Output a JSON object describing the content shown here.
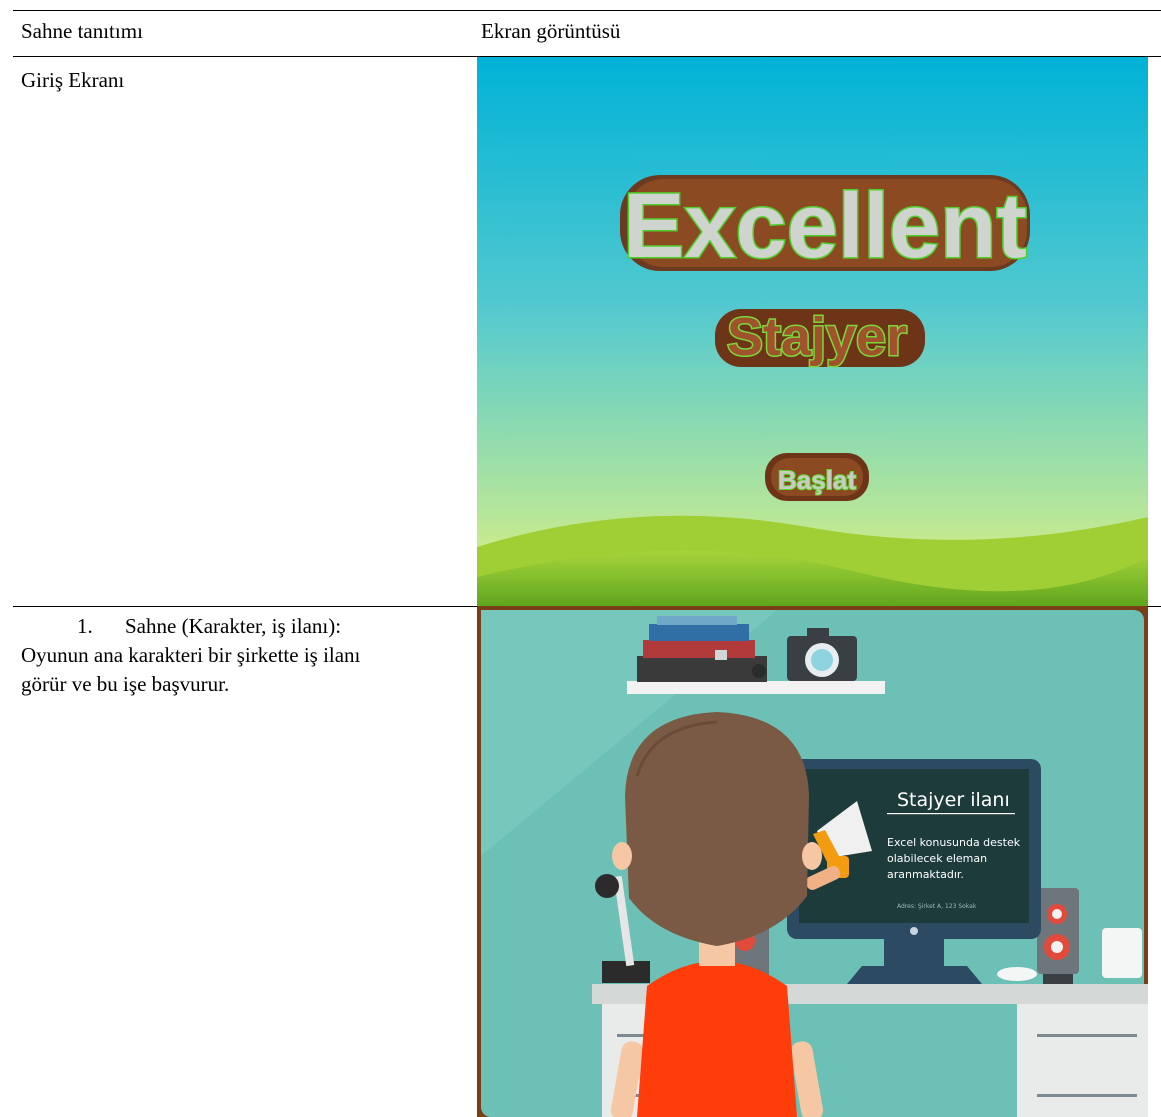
{
  "table": {
    "headers": {
      "left": "Sahne tanıtımı",
      "right": "Ekran görüntüsü"
    },
    "rows": [
      {
        "description": "Giriş Ekranı",
        "screen": {
          "title_line1": "Excellent",
          "title_line2": "Stajyer",
          "start_button": "Başlat",
          "colors": {
            "sky_top": "#00b2d6",
            "sky_bottom": "#e7f27c",
            "hill": "#7fbf2c",
            "title_fill": "#cfd4cf",
            "title_outline": "#4fcf2b",
            "title_shadow": "#5a2a14"
          }
        }
      },
      {
        "description_number": "1.",
        "description_heading": "Sahne (Karakter, iş ilanı):",
        "description_line2": "Oyunun ana karakteri bir şirkette iş ilanı",
        "description_line3": "görür ve bu işe başvurur.",
        "screen": {
          "monitor_title": "Stajyer ilanı",
          "monitor_body_1": "Excel konusunda destek",
          "monitor_body_2": "olabilecek eleman",
          "monitor_body_3": "aranmaktadır.",
          "monitor_footer": "Adres: Şirket A, 123 Sokak",
          "colors": {
            "wall": "#6cc0b6",
            "desk": "#d4d8d6",
            "shirt": "#ff3d0a",
            "hair": "#7b5a45",
            "monitor": "#2d4a63",
            "screen": "#1d3b3b",
            "frame": "#7a3f16"
          }
        }
      }
    ]
  }
}
